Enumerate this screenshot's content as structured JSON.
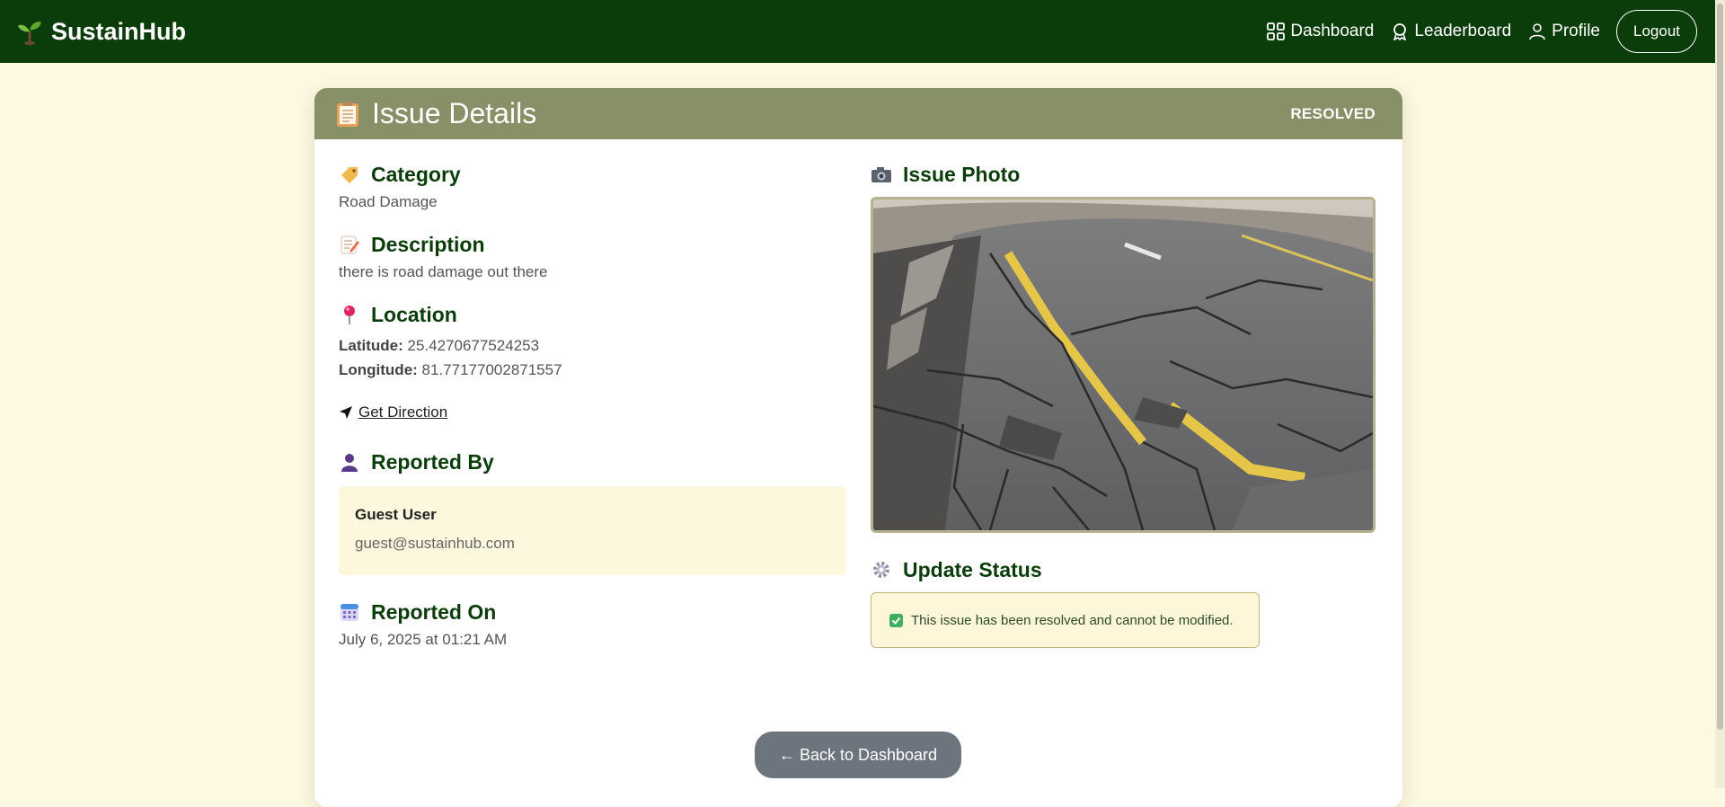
{
  "nav": {
    "brand": "SustainHub",
    "links": [
      {
        "label": "Dashboard",
        "icon": "grid-icon"
      },
      {
        "label": "Leaderboard",
        "icon": "trophy-icon"
      },
      {
        "label": "Profile",
        "icon": "user-icon"
      }
    ],
    "logout": "Logout"
  },
  "issue": {
    "header_title": "Issue Details",
    "status": "RESOLVED",
    "category": {
      "title": "Category",
      "value": "Road Damage"
    },
    "description": {
      "title": "Description",
      "value": "there is road damage out there"
    },
    "location": {
      "title": "Location",
      "latitude_label": "Latitude:",
      "latitude": "25.4270677524253",
      "longitude_label": "Longitude:",
      "longitude": "81.77177002871557",
      "direction_link": "Get Direction"
    },
    "reported_by": {
      "title": "Reported By",
      "name": "Guest User",
      "email": "guest@sustainhub.com"
    },
    "reported_on": {
      "title": "Reported On",
      "value": "July 6, 2025 at 01:21 AM"
    },
    "photo": {
      "title": "Issue Photo"
    },
    "update_status": {
      "title": "Update Status",
      "message": "This issue has been resolved and cannot be modified."
    },
    "back_button": "← Back to Dashboard"
  },
  "colors": {
    "navbar": "#0b3d0b",
    "header_band": "#879066",
    "page_bg": "#fdf8e1",
    "accent_text": "#0b3d0b",
    "button": "#6c757d"
  }
}
